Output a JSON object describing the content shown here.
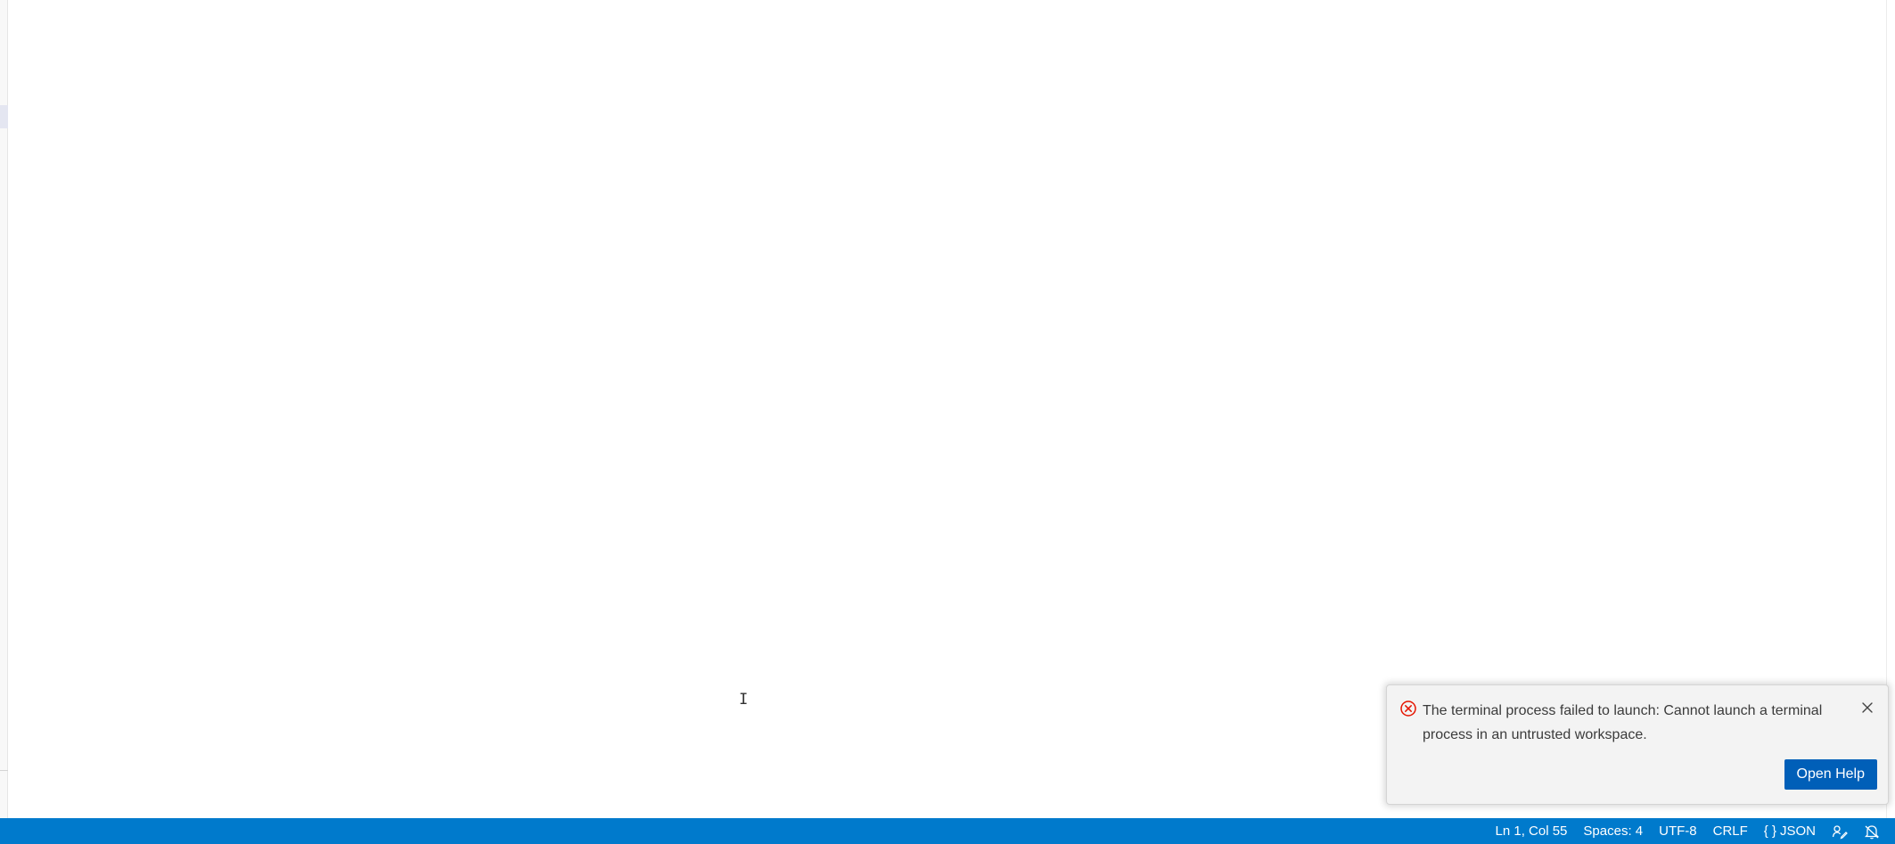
{
  "notification": {
    "severity": "error",
    "message": "The terminal process failed to launch: Cannot launch a terminal process in an untrusted workspace.",
    "action_label": "Open Help",
    "error_color": "#e51400"
  },
  "statusbar": {
    "background": "#007acc",
    "position": "Ln 1, Col 55",
    "indentation": "Spaces: 4",
    "encoding": "UTF-8",
    "line_ending": "CRLF",
    "language_icon": "{ }",
    "language": "JSON",
    "feedback_icon": "feedback-icon",
    "notifications_icon": "bell-icon"
  }
}
